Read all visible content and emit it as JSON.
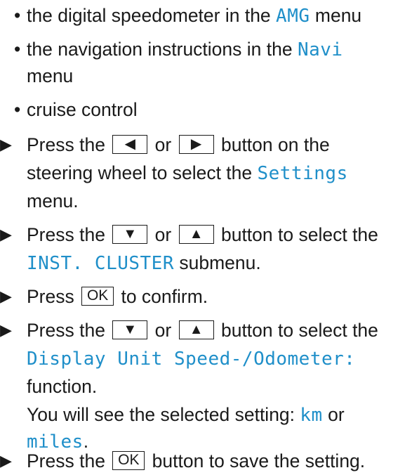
{
  "bullet_char": "•",
  "step_char": "▶",
  "bullets": [
    {
      "pre": "the digital speedometer in the ",
      "code": "AMG",
      "post": " menu"
    },
    {
      "pre": "the navigation instructions in the ",
      "code": "Navi",
      "post": "",
      "cont": "menu"
    },
    {
      "pre": "cruise control"
    }
  ],
  "steps": [
    {
      "a": "Press the ",
      "k1": "◀",
      "mid": " or ",
      "k2": "▶",
      "b": " button on the",
      "line2": "steering wheel to select the ",
      "code": "Settings",
      "line3": "menu."
    },
    {
      "a": "Press the ",
      "k1": "▼",
      "mid": " or ",
      "k2": "▲",
      "b": " button to select the",
      "code": "INST. CLUSTER",
      "after": " submenu."
    },
    {
      "a": "Press ",
      "k1": "OK",
      "b": " to confirm."
    },
    {
      "a": "Press the ",
      "k1": "▼",
      "mid": " or ",
      "k2": "▲",
      "b": " button to select the",
      "code": "Display Unit Speed-/Odometer:",
      "line3": "function.",
      "line4": "You will see the selected setting: ",
      "code_km": "km",
      "or": " or",
      "code_miles": "miles",
      "end": "."
    },
    {
      "a": "Press the ",
      "k1": "OK",
      "b": " button to save the setting."
    }
  ]
}
